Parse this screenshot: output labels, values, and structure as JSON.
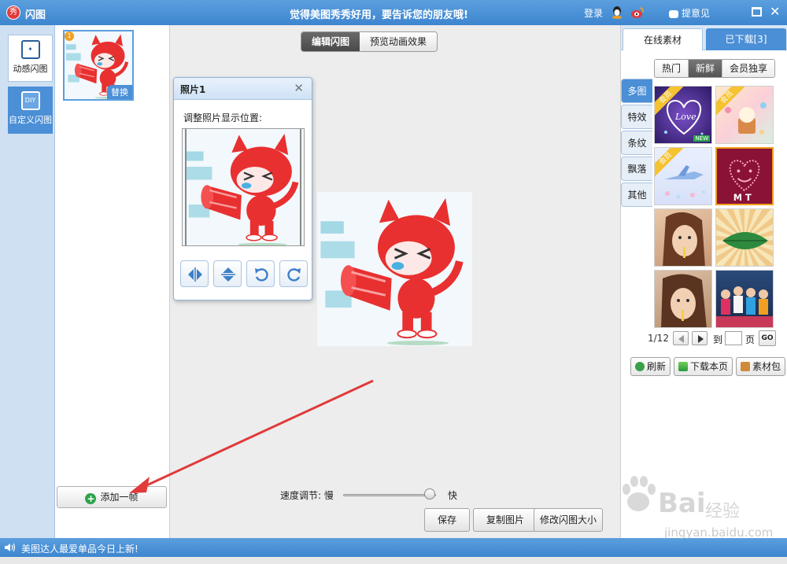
{
  "titlebar": {
    "logo": "秀",
    "app_title": "闪图",
    "slogan": "觉得美图秀秀好用，要告诉您的朋友哦!",
    "login": "登录",
    "feedback": "提意见"
  },
  "modes": [
    {
      "label": "动感闪图",
      "icon": "sparkle-frame-icon"
    },
    {
      "label": "自定义闪图",
      "icon_text": "DIY"
    }
  ],
  "frames": {
    "badge": "1",
    "replace_label": "替换",
    "add_button": "添加一帧"
  },
  "view_toggle": {
    "edit": "编辑闪图",
    "preview": "预览动画效果"
  },
  "dialog": {
    "title": "照片1",
    "instruction": "调整照片显示位置:",
    "tools": [
      "flip-horizontal-icon",
      "flip-vertical-icon",
      "rotate-left-icon",
      "rotate-right-icon"
    ]
  },
  "speed": {
    "label": "速度调节: 慢",
    "fast": "快",
    "value_fraction": 0.93
  },
  "actions": {
    "save": "保存",
    "copy": "复制图片",
    "resize": "修改闪图大小"
  },
  "right": {
    "tab_online": "在线素材",
    "tab_downloaded": "已下载[3]",
    "subtabs": [
      "热门",
      "新鲜",
      "会员独享"
    ],
    "active_subtab": "新鲜",
    "categories": [
      "多图",
      "特效",
      "条纹",
      "飘落",
      "其他"
    ],
    "active_category": "多图",
    "member_label": "会员",
    "new_badge": "NEW",
    "grid_labels": {
      "love": "Love",
      "mt": "M T"
    },
    "pager": {
      "current": "1/12",
      "to": "到",
      "page": "页",
      "go": "GO"
    },
    "buttons": {
      "refresh": "刷新",
      "download": "下载本页",
      "pack": "素材包"
    }
  },
  "status": {
    "text": "美图达人最爱单品今日上新!"
  },
  "watermark": {
    "brand": "Bai",
    "brand2": "经验",
    "url": "jingyan.baidu.com"
  },
  "colors": {
    "title_blue": "#3d85cf",
    "accent_orange": "#f0a020",
    "mascot_red": "#e83030",
    "arrow_red": "#e03a3a"
  }
}
